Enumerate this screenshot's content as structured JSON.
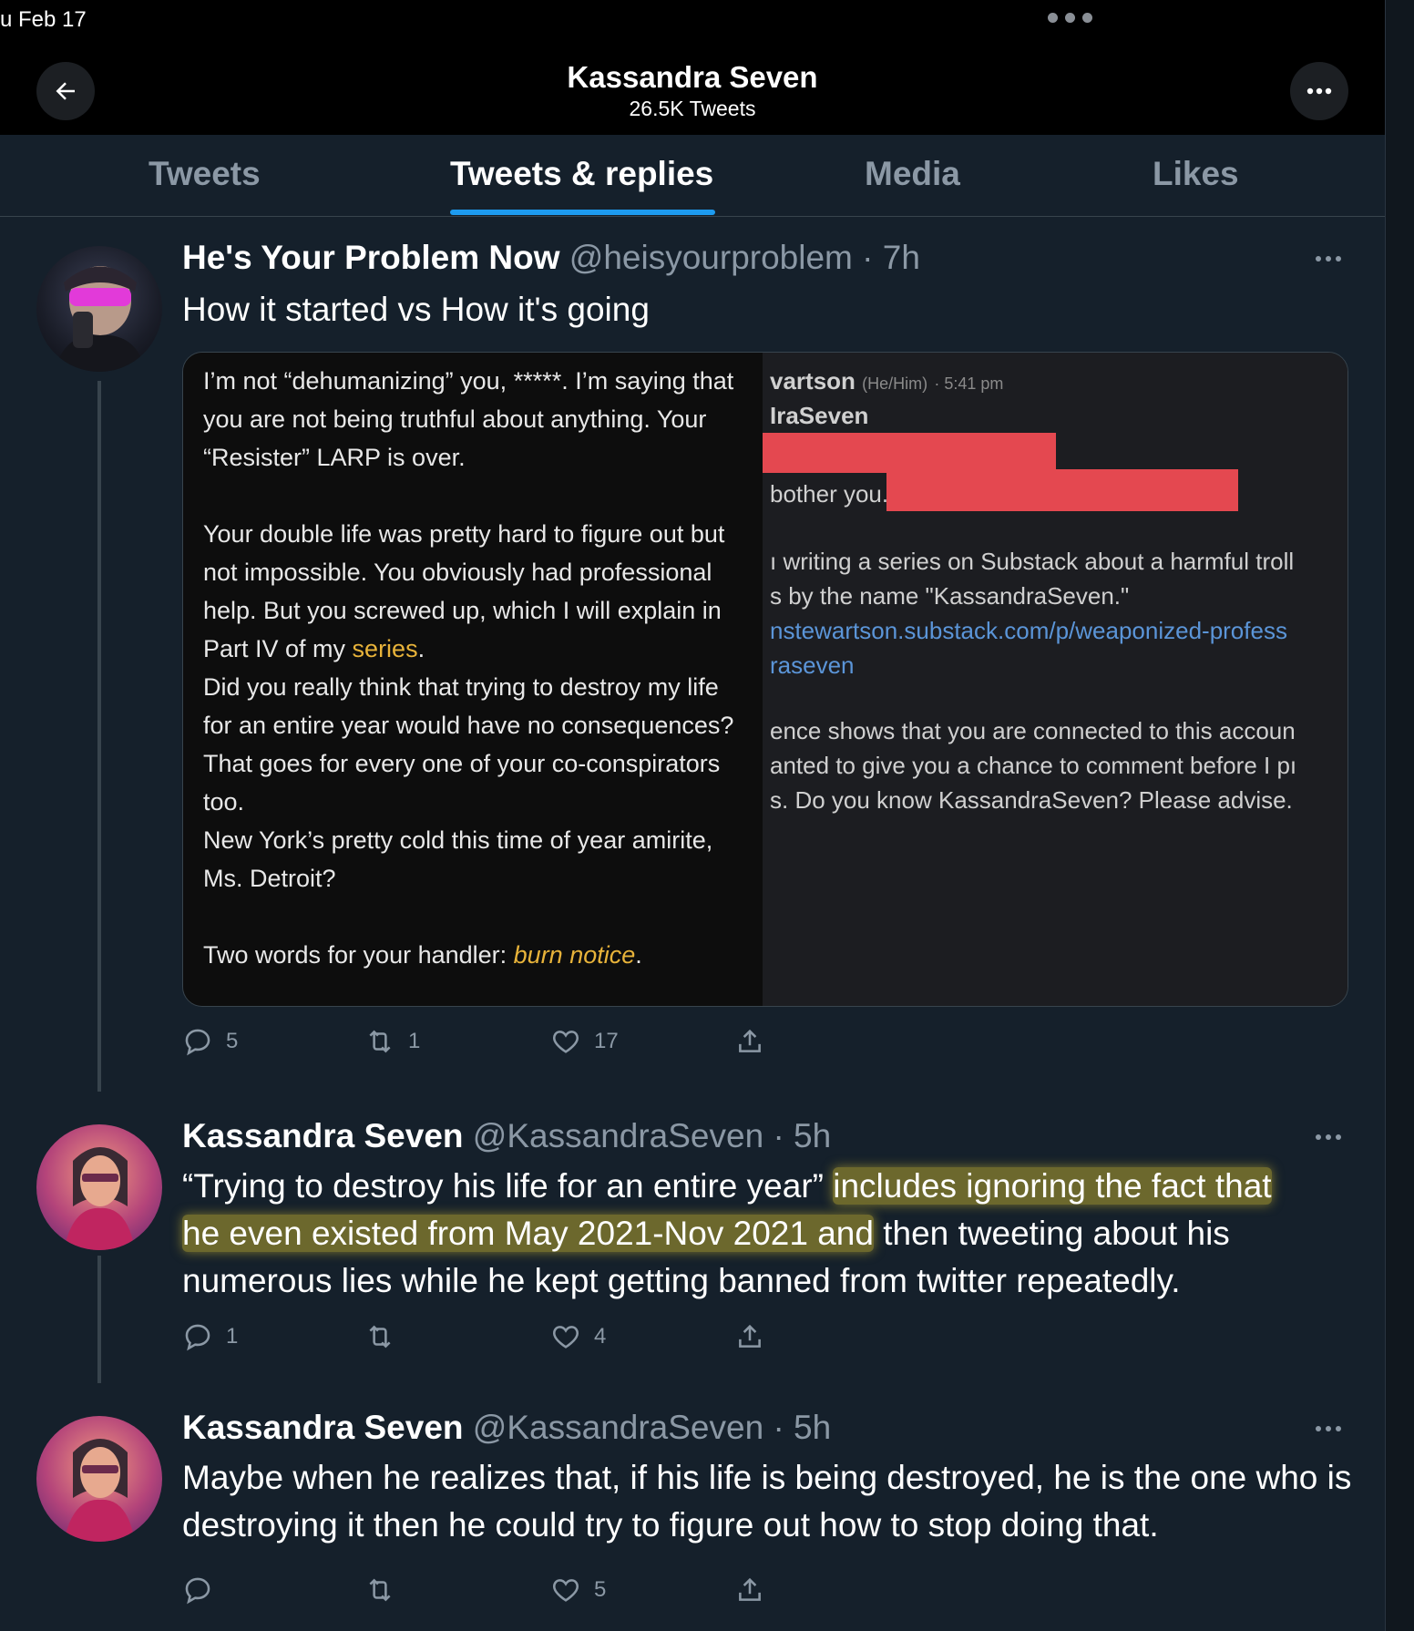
{
  "status_bar": {
    "date": "u Feb 17"
  },
  "header": {
    "title": "Kassandra Seven",
    "subtitle": "26.5K Tweets"
  },
  "tabs": [
    {
      "label": "Tweets"
    },
    {
      "label": "Tweets & replies",
      "active": true
    },
    {
      "label": "Media"
    },
    {
      "label": "Likes"
    }
  ],
  "colors": {
    "accent": "#1d9bf0",
    "background": "#15202b",
    "highlight": "#c4b030",
    "link_gold": "#e8b33a",
    "redaction": "#e44850"
  },
  "tweets": [
    {
      "name": "He's Your Problem Now",
      "handle": "@heisyourproblem",
      "time": "· 7h",
      "text": "How it started vs How it's going",
      "image_card": {
        "left": {
          "p1": "I’m not “dehumanizing” you, *****. I’m saying that you are not being truthful about anything. Your “Resister” LARP is over.",
          "p2_before": "Your double life was pretty hard to figure out but not impossible. You obviously had professional help. But you screwed up, which I will explain in Part IV of my ",
          "p2_link": "series",
          "p2_after": ".",
          "p3": "Did you really think that trying to destroy my life for an entire year would have no consequences? That goes for every one of your co-conspirators too.",
          "p4": "New York’s pretty cold this time of year amirite, Ms. Detroit?",
          "p5_before": "Two words for your handler: ",
          "p5_link": "burn notice",
          "p5_after": "."
        },
        "right": {
          "author": "vartson",
          "pronouns": "(He/Him)",
          "time": "· 5:41 pm",
          "reply_to": "IraSeven",
          "line_bother": "bother you.",
          "line1": "ı writing a series on Substack about a harmful troll",
          "line2": "s by the name \"KassandraSeven.\"",
          "link1": "nstewartson.substack.com/p/weaponized-profess",
          "link2": "raseven",
          "line3": "ence shows that you are connected to this accoun",
          "line4": "anted to give you a chance to comment before I pı",
          "line5": "s. Do you know KassandraSeven? Please advise."
        }
      },
      "replies": "5",
      "retweets": "1",
      "likes": "17"
    },
    {
      "name": "Kassandra Seven",
      "handle": "@KassandraSeven",
      "time": "· 5h",
      "text_a": "“Trying to destroy his life for an entire year” ",
      "text_hl1": "includes ignoring the fact that",
      "text_hl2": "he even existed from May 2021-Nov 2021 and",
      "text_b": " then tweeting about his numerous lies while he kept getting banned from twitter repeatedly.",
      "replies": "1",
      "retweets": "",
      "likes": "4"
    },
    {
      "name": "Kassandra Seven",
      "handle": "@KassandraSeven",
      "time": "· 5h",
      "text": "Maybe when he realizes that, if his life is being destroyed, he is the one who is destroying it then he could try to figure out how to stop doing that.",
      "replies": "",
      "retweets": "",
      "likes": "5"
    }
  ]
}
